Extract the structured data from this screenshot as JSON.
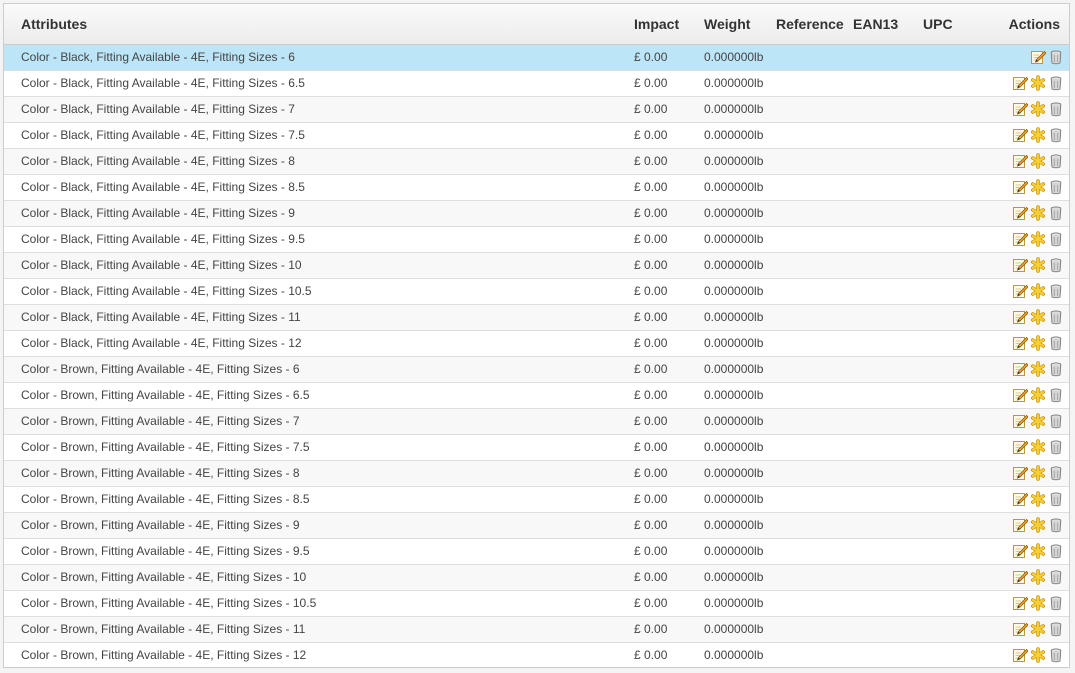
{
  "table": {
    "headers": {
      "attributes": "Attributes",
      "impact": "Impact",
      "weight": "Weight",
      "reference": "Reference",
      "ean13": "EAN13",
      "upc": "UPC",
      "actions": "Actions"
    },
    "rows": [
      {
        "attributes": "Color - Black, Fitting Available - 4E, Fitting Sizes - 6",
        "impact": "£ 0.00",
        "weight": "0.000000lb",
        "reference": "",
        "ean13": "",
        "upc": "",
        "is_default": true
      },
      {
        "attributes": "Color - Black, Fitting Available - 4E, Fitting Sizes - 6.5",
        "impact": "£ 0.00",
        "weight": "0.000000lb",
        "reference": "",
        "ean13": "",
        "upc": "",
        "is_default": false
      },
      {
        "attributes": "Color - Black, Fitting Available - 4E, Fitting Sizes - 7",
        "impact": "£ 0.00",
        "weight": "0.000000lb",
        "reference": "",
        "ean13": "",
        "upc": "",
        "is_default": false
      },
      {
        "attributes": "Color - Black, Fitting Available - 4E, Fitting Sizes - 7.5",
        "impact": "£ 0.00",
        "weight": "0.000000lb",
        "reference": "",
        "ean13": "",
        "upc": "",
        "is_default": false
      },
      {
        "attributes": "Color - Black, Fitting Available - 4E, Fitting Sizes - 8",
        "impact": "£ 0.00",
        "weight": "0.000000lb",
        "reference": "",
        "ean13": "",
        "upc": "",
        "is_default": false
      },
      {
        "attributes": "Color - Black, Fitting Available - 4E, Fitting Sizes - 8.5",
        "impact": "£ 0.00",
        "weight": "0.000000lb",
        "reference": "",
        "ean13": "",
        "upc": "",
        "is_default": false
      },
      {
        "attributes": "Color - Black, Fitting Available - 4E, Fitting Sizes - 9",
        "impact": "£ 0.00",
        "weight": "0.000000lb",
        "reference": "",
        "ean13": "",
        "upc": "",
        "is_default": false
      },
      {
        "attributes": "Color - Black, Fitting Available - 4E, Fitting Sizes - 9.5",
        "impact": "£ 0.00",
        "weight": "0.000000lb",
        "reference": "",
        "ean13": "",
        "upc": "",
        "is_default": false
      },
      {
        "attributes": "Color - Black, Fitting Available - 4E, Fitting Sizes - 10",
        "impact": "£ 0.00",
        "weight": "0.000000lb",
        "reference": "",
        "ean13": "",
        "upc": "",
        "is_default": false
      },
      {
        "attributes": "Color - Black, Fitting Available - 4E, Fitting Sizes - 10.5",
        "impact": "£ 0.00",
        "weight": "0.000000lb",
        "reference": "",
        "ean13": "",
        "upc": "",
        "is_default": false
      },
      {
        "attributes": "Color - Black, Fitting Available - 4E, Fitting Sizes - 11",
        "impact": "£ 0.00",
        "weight": "0.000000lb",
        "reference": "",
        "ean13": "",
        "upc": "",
        "is_default": false
      },
      {
        "attributes": "Color - Black, Fitting Available - 4E, Fitting Sizes - 12",
        "impact": "£ 0.00",
        "weight": "0.000000lb",
        "reference": "",
        "ean13": "",
        "upc": "",
        "is_default": false
      },
      {
        "attributes": "Color - Brown, Fitting Available - 4E, Fitting Sizes - 6",
        "impact": "£ 0.00",
        "weight": "0.000000lb",
        "reference": "",
        "ean13": "",
        "upc": "",
        "is_default": false
      },
      {
        "attributes": "Color - Brown, Fitting Available - 4E, Fitting Sizes - 6.5",
        "impact": "£ 0.00",
        "weight": "0.000000lb",
        "reference": "",
        "ean13": "",
        "upc": "",
        "is_default": false
      },
      {
        "attributes": "Color - Brown, Fitting Available - 4E, Fitting Sizes - 7",
        "impact": "£ 0.00",
        "weight": "0.000000lb",
        "reference": "",
        "ean13": "",
        "upc": "",
        "is_default": false
      },
      {
        "attributes": "Color - Brown, Fitting Available - 4E, Fitting Sizes - 7.5",
        "impact": "£ 0.00",
        "weight": "0.000000lb",
        "reference": "",
        "ean13": "",
        "upc": "",
        "is_default": false
      },
      {
        "attributes": "Color - Brown, Fitting Available - 4E, Fitting Sizes - 8",
        "impact": "£ 0.00",
        "weight": "0.000000lb",
        "reference": "",
        "ean13": "",
        "upc": "",
        "is_default": false
      },
      {
        "attributes": "Color - Brown, Fitting Available - 4E, Fitting Sizes - 8.5",
        "impact": "£ 0.00",
        "weight": "0.000000lb",
        "reference": "",
        "ean13": "",
        "upc": "",
        "is_default": false
      },
      {
        "attributes": "Color - Brown, Fitting Available - 4E, Fitting Sizes - 9",
        "impact": "£ 0.00",
        "weight": "0.000000lb",
        "reference": "",
        "ean13": "",
        "upc": "",
        "is_default": false
      },
      {
        "attributes": "Color - Brown, Fitting Available - 4E, Fitting Sizes - 9.5",
        "impact": "£ 0.00",
        "weight": "0.000000lb",
        "reference": "",
        "ean13": "",
        "upc": "",
        "is_default": false
      },
      {
        "attributes": "Color - Brown, Fitting Available - 4E, Fitting Sizes - 10",
        "impact": "£ 0.00",
        "weight": "0.000000lb",
        "reference": "",
        "ean13": "",
        "upc": "",
        "is_default": false
      },
      {
        "attributes": "Color - Brown, Fitting Available - 4E, Fitting Sizes - 10.5",
        "impact": "£ 0.00",
        "weight": "0.000000lb",
        "reference": "",
        "ean13": "",
        "upc": "",
        "is_default": false
      },
      {
        "attributes": "Color - Brown, Fitting Available - 4E, Fitting Sizes - 11",
        "impact": "£ 0.00",
        "weight": "0.000000lb",
        "reference": "",
        "ean13": "",
        "upc": "",
        "is_default": false
      },
      {
        "attributes": "Color - Brown, Fitting Available - 4E, Fitting Sizes - 12",
        "impact": "£ 0.00",
        "weight": "0.000000lb",
        "reference": "",
        "ean13": "",
        "upc": "",
        "is_default": false
      }
    ]
  },
  "icons": {
    "edit": "pencil-edit-icon",
    "default": "asterisk-default-icon",
    "delete": "trash-can-icon"
  },
  "colors": {
    "selected_row": "#bde5f8",
    "even_row": "#f8f8f8",
    "odd_row": "#ffffff",
    "border": "#dedede",
    "asterisk": "#f2c01e"
  }
}
